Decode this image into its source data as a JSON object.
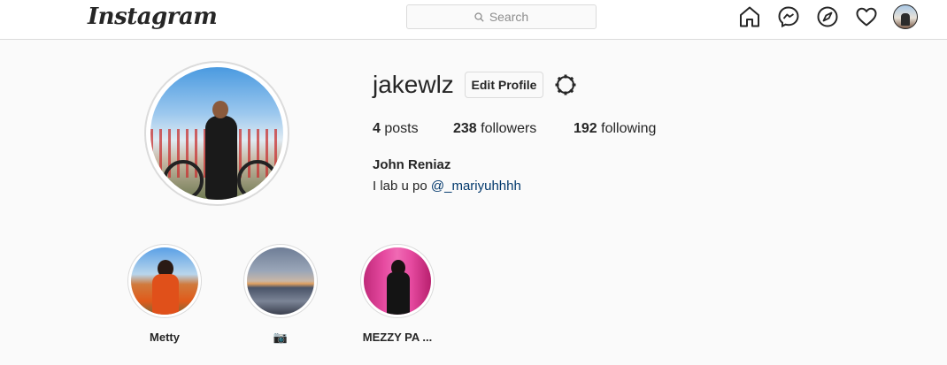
{
  "nav": {
    "logo": "Instagram",
    "search_placeholder": "Search",
    "icons": [
      "home-icon",
      "messenger-icon",
      "explore-icon",
      "heart-icon"
    ]
  },
  "profile": {
    "username": "jakewlz",
    "edit_label": "Edit Profile",
    "stats": {
      "posts_count": "4",
      "posts_label": "posts",
      "followers_count": "238",
      "followers_label": "followers",
      "following_count": "192",
      "following_label": "following"
    },
    "full_name": "John Reniaz",
    "bio_text": "I lab u po ",
    "bio_mention": "@_mariyuhhhh"
  },
  "highlights": [
    {
      "label": "Metty"
    },
    {
      "label": "📷"
    },
    {
      "label": "MEZZY PA ..."
    }
  ],
  "colors": {
    "background": "#fafafa",
    "border": "#dbdbdb",
    "text": "#262626",
    "link": "#00376b"
  }
}
